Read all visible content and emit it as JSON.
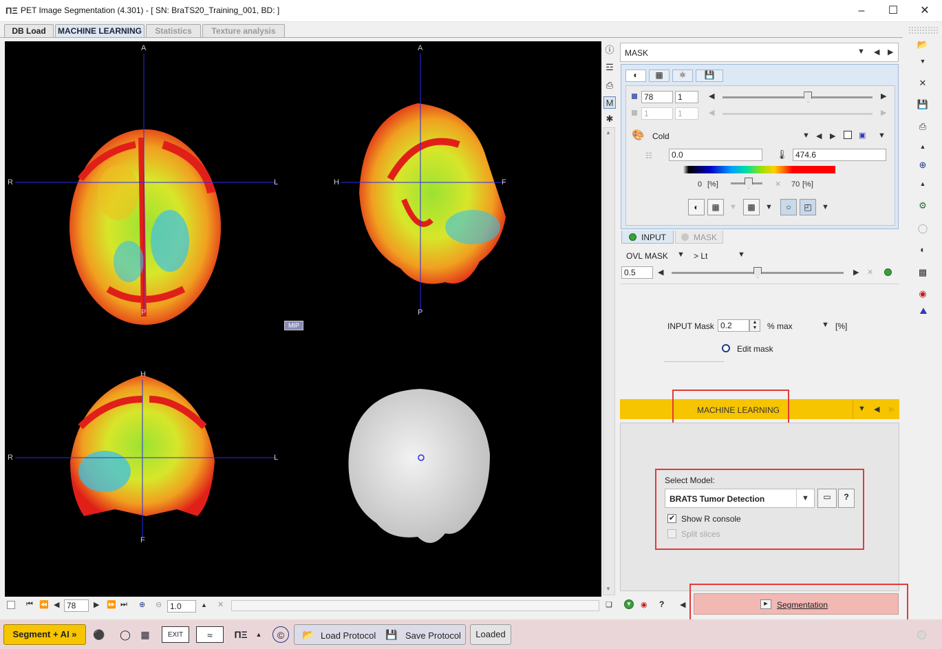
{
  "window": {
    "title": "PET Image Segmentation (4.301) - [ SN: BraTS20_Training_001, BD:  ]"
  },
  "tabs": [
    {
      "label": "DB Load"
    },
    {
      "label": "MACHINE LEARNING"
    },
    {
      "label": "Statistics"
    },
    {
      "label": "Texture analysis"
    }
  ],
  "viewer": {
    "axial": {
      "top": "A",
      "bottom": "P",
      "left": "R",
      "right": "L"
    },
    "sagittal": {
      "top": "A",
      "bottom": "P",
      "left": "H",
      "right": "F"
    },
    "coronal": {
      "top": "H",
      "bottom": "F",
      "left": "R",
      "right": "L"
    },
    "mip_label": "MIP"
  },
  "viewer_controls": {
    "slice": "78",
    "zoom": "1.0"
  },
  "panel": {
    "mask_combo": "MASK",
    "slice_value": "78",
    "slice_step": "1",
    "slice_value2": "1",
    "slice_step2": "1",
    "slice_slider": 0.57,
    "colormap": "Cold",
    "range_min": "0.0",
    "range_max": "474.6",
    "lower_pct": "0",
    "upper_pct": "70",
    "pct_unit": "[%]",
    "input_tab": "INPUT",
    "mask_tab": "MASK",
    "ovl_mask": "OVL MASK",
    "threshold_mode": "> Lt",
    "ovl_value": "0.5",
    "ovl_slider": 0.5,
    "input_mask_label": "INPUT Mask",
    "input_mask_value": "0.2",
    "input_mask_unit": "% max",
    "input_mask_pct": "[%]",
    "edit_mask": "Edit mask"
  },
  "ml": {
    "header": "MACHINE LEARNING",
    "select_model_label": "Select Model:",
    "model": "BRATS Tumor Detection",
    "help": "?",
    "show_r_console": "Show R console",
    "show_r_console_checked": true,
    "split_slices": "Split slices",
    "segmentation_button": "Segmentation"
  },
  "bottom": {
    "segment_ai": "Segment + AI »",
    "load_protocol": "Load Protocol",
    "save_protocol": "Save Protocol",
    "loaded": "Loaded",
    "exit": "EXIT"
  },
  "colors": {
    "accent": "#f7c400",
    "highlight": "#e23a3a",
    "crosshair": "#2a2af0",
    "seg_button": "#f1b8b4"
  }
}
